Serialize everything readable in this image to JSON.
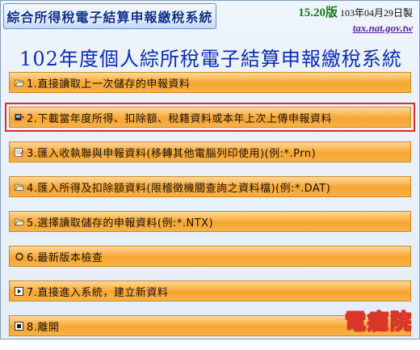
{
  "header": {
    "app_title": "綜合所得稅電子結算申報繳稅系統",
    "version": "15.20版",
    "build_date": "103年04月29日製",
    "website": "tax.nat.gov.tw"
  },
  "main_title": "102年度個人綜所稅電子結算申報繳稅系統",
  "menu": {
    "selected_index": 1,
    "items": [
      {
        "label": "1.直接讀取上一次儲存的申報資料",
        "icon": "folder-open-icon"
      },
      {
        "label": "2.下載當年度所得、扣除額、稅籍資料或本年上次上傳申報資料",
        "icon": "download-icon"
      },
      {
        "label": "3.匯入收執聯與申報資料(移轉其他電腦列印使用)(例:*.Prn)",
        "icon": "import-icon"
      },
      {
        "label": "4.匯入所得及扣除額資料(限稽徵機關查詢之資料檔)(例:*.DAT)",
        "icon": "folder-open-icon"
      },
      {
        "label": "5.選擇讀取儲存的申報資料(例:*.NTX)",
        "icon": "folder-open-icon"
      },
      {
        "label": "6.最新版本檢查",
        "icon": "refresh-icon"
      },
      {
        "label": "7.直接進入系統，建立新資料",
        "icon": "enter-icon"
      },
      {
        "label": "8.離開",
        "icon": "exit-icon"
      }
    ]
  },
  "watermark": "電癮院"
}
